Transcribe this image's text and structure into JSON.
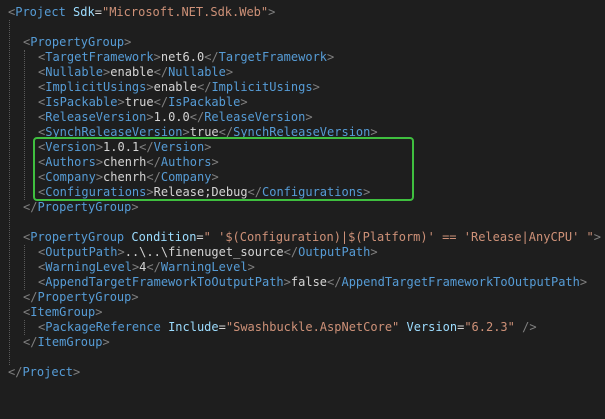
{
  "editor": {
    "colors": {
      "background": "#1e1e1e",
      "tag": "#569cd6",
      "attribute": "#9cdcfe",
      "string": "#ce9178",
      "text": "#d4d4d4",
      "bracket": "#808080",
      "highlight_box": "#3fbf3f"
    },
    "lines": [
      {
        "indent": 0,
        "kind": "open_attr",
        "tag": "Project",
        "attrs": [
          {
            "name": "Sdk",
            "value": "\"Microsoft.NET.Sdk.Web\""
          }
        ]
      },
      {
        "indent": 0,
        "kind": "blank"
      },
      {
        "indent": 1,
        "kind": "open",
        "tag": "PropertyGroup"
      },
      {
        "indent": 2,
        "kind": "element",
        "tag": "TargetFramework",
        "text": "net6.0"
      },
      {
        "indent": 2,
        "kind": "element",
        "tag": "Nullable",
        "text": "enable"
      },
      {
        "indent": 2,
        "kind": "element",
        "tag": "ImplicitUsings",
        "text": "enable"
      },
      {
        "indent": 2,
        "kind": "element",
        "tag": "IsPackable",
        "text": "true"
      },
      {
        "indent": 2,
        "kind": "element",
        "tag": "ReleaseVersion",
        "text": "1.0.0"
      },
      {
        "indent": 2,
        "kind": "element",
        "tag": "SynchReleaseVersion",
        "text": "true"
      },
      {
        "indent": 2,
        "kind": "element",
        "tag": "Version",
        "text": "1.0.1"
      },
      {
        "indent": 2,
        "kind": "element",
        "tag": "Authors",
        "text": "chenrh"
      },
      {
        "indent": 2,
        "kind": "element",
        "tag": "Company",
        "text": "chenrh"
      },
      {
        "indent": 2,
        "kind": "element",
        "tag": "Configurations",
        "text": "Release;Debug"
      },
      {
        "indent": 1,
        "kind": "close",
        "tag": "PropertyGroup"
      },
      {
        "indent": 0,
        "kind": "blank"
      },
      {
        "indent": 1,
        "kind": "open_attr",
        "tag": "PropertyGroup",
        "attrs": [
          {
            "name": "Condition",
            "value": "\" '$(Configuration)|$(Platform)' == 'Release|AnyCPU' \""
          }
        ]
      },
      {
        "indent": 2,
        "kind": "element",
        "tag": "OutputPath",
        "text": "..\\..\\finenuget_source"
      },
      {
        "indent": 2,
        "kind": "element",
        "tag": "WarningLevel",
        "text": "4"
      },
      {
        "indent": 2,
        "kind": "element",
        "tag": "AppendTargetFrameworkToOutputPath",
        "text": "false"
      },
      {
        "indent": 1,
        "kind": "close",
        "tag": "PropertyGroup"
      },
      {
        "indent": 1,
        "kind": "open",
        "tag": "ItemGroup"
      },
      {
        "indent": 2,
        "kind": "selfclose",
        "tag": "PackageReference",
        "attrs": [
          {
            "name": "Include",
            "value": "\"Swashbuckle.AspNetCore\""
          },
          {
            "name": "Version",
            "value": "\"6.2.3\""
          }
        ]
      },
      {
        "indent": 1,
        "kind": "close",
        "tag": "ItemGroup"
      },
      {
        "indent": 0,
        "kind": "blank"
      },
      {
        "indent": 0,
        "kind": "close",
        "tag": "Project"
      }
    ]
  }
}
